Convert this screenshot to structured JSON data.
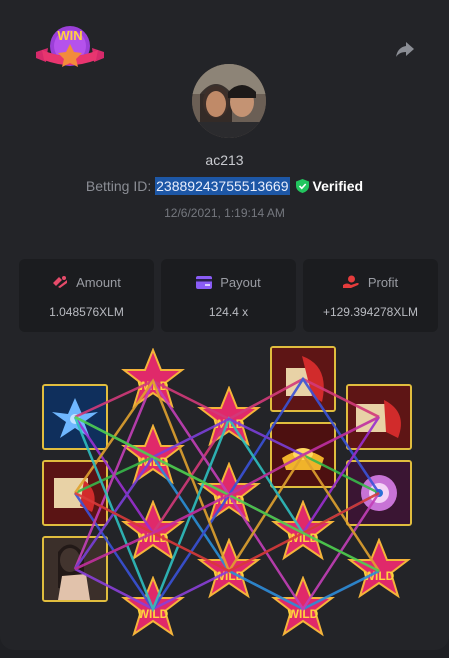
{
  "header": {
    "username": "ac213",
    "betting_id_label": "Betting ID:",
    "betting_id": "23889243755513669",
    "verified_label": "Verified",
    "datetime": "12/6/2021, 1:19:14 AM",
    "logo_text": "WIN"
  },
  "stats": [
    {
      "label": "Amount",
      "value": "1.048576XLM",
      "icon": "amount-icon",
      "color": "#e64b6a"
    },
    {
      "label": "Payout",
      "value": "124.4 x",
      "icon": "payout-card-icon",
      "color": "#8a5cf6"
    },
    {
      "label": "Profit",
      "value": "+129.394278XLM",
      "icon": "profit-icon",
      "color": "#e53c3c"
    }
  ],
  "reels": {
    "wild_label": "WILD",
    "symbols": [
      "blue-flower",
      "scroll",
      "lady",
      "scroll-red",
      "gold-ingot",
      "scroll-right",
      "purple-flower"
    ]
  },
  "colors": {
    "accent_verified": "#22c55e",
    "frame_gold": "#e0bd3e",
    "selection": "#1d57a6"
  }
}
